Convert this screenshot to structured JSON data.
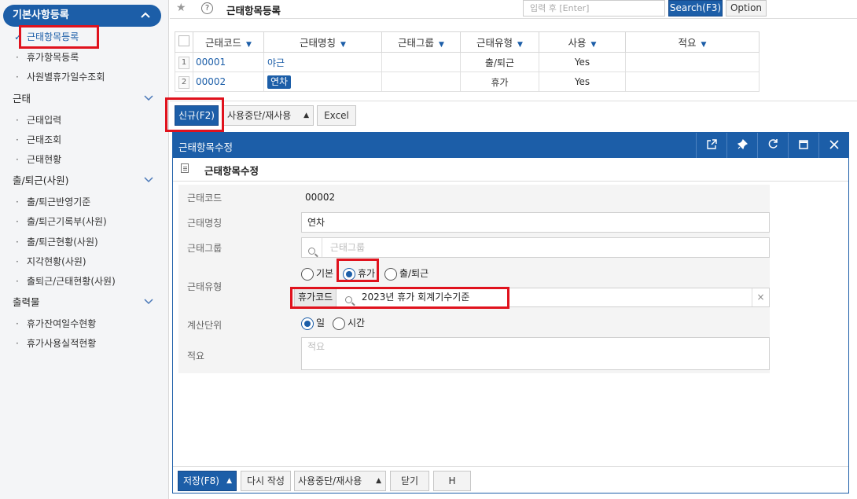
{
  "sidebar": {
    "top_group": "기본사항등록",
    "top_items": [
      "근태항목등록",
      "휴가항목등록",
      "사원별휴가일수조회"
    ],
    "groups": [
      {
        "title": "근태",
        "items": [
          "근태입력",
          "근태조회",
          "근태현황"
        ]
      },
      {
        "title": "출/퇴근(사원)",
        "items": [
          "출/퇴근반영기준",
          "출/퇴근기록부(사원)",
          "출/퇴근현황(사원)",
          "지각현황(사원)",
          "출퇴근/근태현황(사원)"
        ]
      },
      {
        "title": "출력물",
        "items": [
          "휴가잔여일수현황",
          "휴가사용실적현황"
        ]
      }
    ]
  },
  "topbar": {
    "title": "근태항목등록",
    "search_placeholder": "입력 후 [Enter]",
    "search_button": "Search(F3)",
    "option_button": "Option"
  },
  "grid": {
    "columns": [
      "근태코드",
      "근태명칭",
      "근태그룹",
      "근태유형",
      "사용",
      "적요"
    ],
    "rows": [
      {
        "num": "1",
        "code": "00001",
        "name": "야근",
        "group": "",
        "type": "출/퇴근",
        "use": "Yes",
        "note": ""
      },
      {
        "num": "2",
        "code": "00002",
        "name": "연차",
        "group": "",
        "type": "휴가",
        "use": "Yes",
        "note": ""
      }
    ]
  },
  "actions": {
    "new": "신규(F2)",
    "toggle": "사용중단/재사용",
    "excel": "Excel"
  },
  "dialog": {
    "title": "근태항목수정",
    "subtitle": "근태항목수정",
    "fields": {
      "code_label": "근태코드",
      "code_value": "00002",
      "name_label": "근태명칭",
      "name_value": "연차",
      "group_label": "근태그룹",
      "group_placeholder": "근태그룹",
      "type_label": "근태유형",
      "type_options": [
        "기본",
        "휴가",
        "출/퇴근"
      ],
      "type_selected": "휴가",
      "vacation_code_label": "휴가코드",
      "vacation_code_value": "2023년 휴가 회계기수기준",
      "unit_label": "계산단위",
      "unit_options": [
        "일",
        "시간"
      ],
      "unit_selected": "일",
      "memo_label": "적요",
      "memo_placeholder": "적요"
    },
    "footer": {
      "save": "저장(F8)",
      "rewrite": "다시 작성",
      "toggle": "사용중단/재사용",
      "close": "닫기",
      "h": "H"
    }
  },
  "colors": {
    "primary": "#1c5ea8",
    "highlight": "#e0121d"
  }
}
